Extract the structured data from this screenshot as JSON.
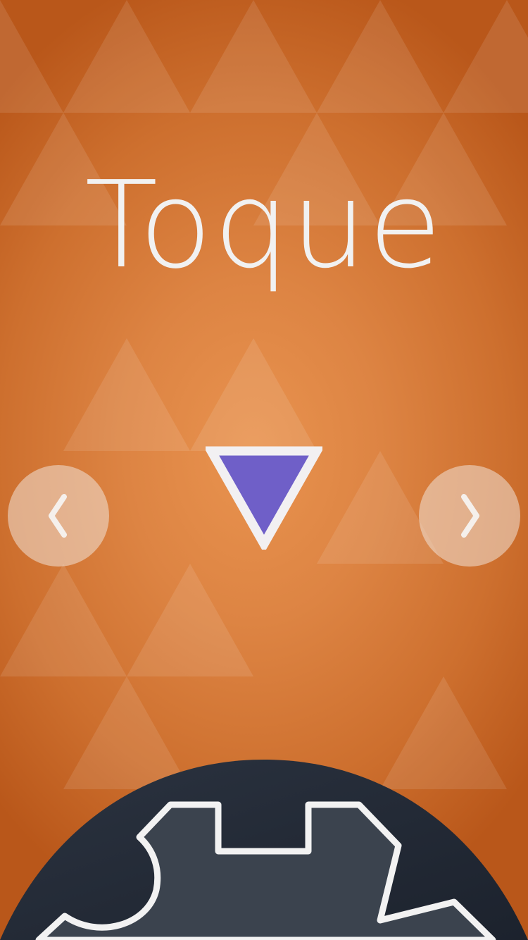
{
  "title": "Toque",
  "navigation": {
    "prev_icon": "chevron-left-icon",
    "next_icon": "chevron-right-icon"
  },
  "shape": {
    "type": "triangle-down",
    "fill_color": "#6f5fc8",
    "stroke_color": "#f2f0f2"
  },
  "menu": {
    "icon": "gear-icon",
    "dome_color": "#262d3a"
  },
  "colors": {
    "background": "#d97c3a",
    "text": "#f1f1f1"
  }
}
